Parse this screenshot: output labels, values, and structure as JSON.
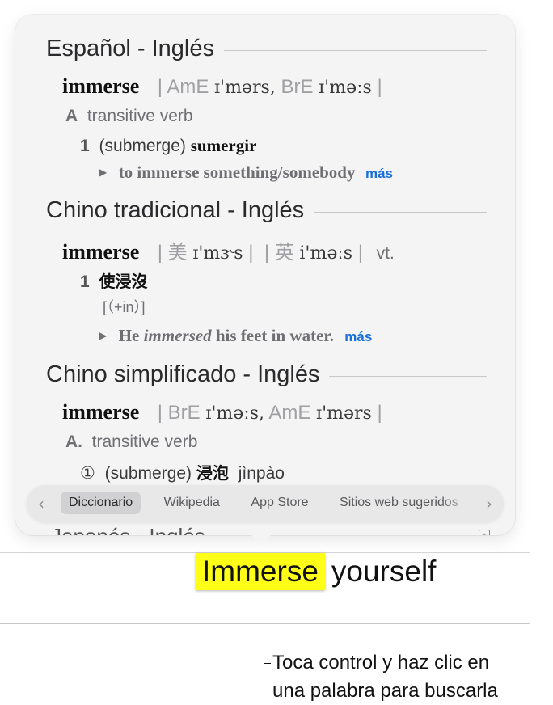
{
  "dictionary": {
    "sections": [
      {
        "title": "Español - Inglés",
        "headword": "immerse",
        "pron_prefix": "|",
        "pron_1_region": "AmE",
        "pron_1_ipa": "ɪ'mərs,",
        "pron_2_region": "BrE",
        "pron_2_ipa": "ɪ'məːs",
        "pron_suffix": "|",
        "pos_letter": "A",
        "pos_label": "transitive verb",
        "sense_num": "1",
        "sense_context": "(submerge)",
        "sense_translation": "sumergir",
        "example": "to immerse something/somebody",
        "more_label": "más"
      },
      {
        "title": "Chino tradicional - Inglés",
        "headword": "immerse",
        "pron_1": "| 美",
        "pron_1_ipa": "ɪ'mɝs",
        "pron_1_end": "|",
        "pron_2": "| 英",
        "pron_2_ipa": "i'məːs",
        "pron_2_end": "|",
        "pos_label": "vt.",
        "sense_num": "1",
        "sense_translation": "使浸沒",
        "grammar": "[（+in）]",
        "example_pre": "He",
        "example_italic": "immersed",
        "example_post": "his feet in water.",
        "more_label": "más"
      },
      {
        "title": "Chino simplificado - Inglés",
        "headword": "immerse",
        "pron_prefix": "|",
        "pron_1_region": "BrE",
        "pron_1_ipa": "ɪ'məːs,",
        "pron_2_region": "AmE",
        "pron_2_ipa": "ɪ'mərs",
        "pron_suffix": "|",
        "pos_letter": "A.",
        "pos_label": "transitive verb",
        "sense_num": "①",
        "sense_context": "(submerge)",
        "sense_translation": "浸泡",
        "sense_pinyin": "jìnpào"
      }
    ],
    "next_section_title": "Japonés - Inglés"
  },
  "tabbar": {
    "tabs": [
      "Diccionario",
      "Wikipedia",
      "App Store",
      "Sitios web sugeridos"
    ],
    "active_tab": "Diccionario",
    "prev_arrow": "‹",
    "next_arrow": "›"
  },
  "document": {
    "highlighted_word": "Immerse",
    "rest_text": "yourself",
    "highlight_color": "#ffff18"
  },
  "callout": {
    "line1": "Toca control y haz clic en",
    "line2": "una palabra para buscarla"
  }
}
